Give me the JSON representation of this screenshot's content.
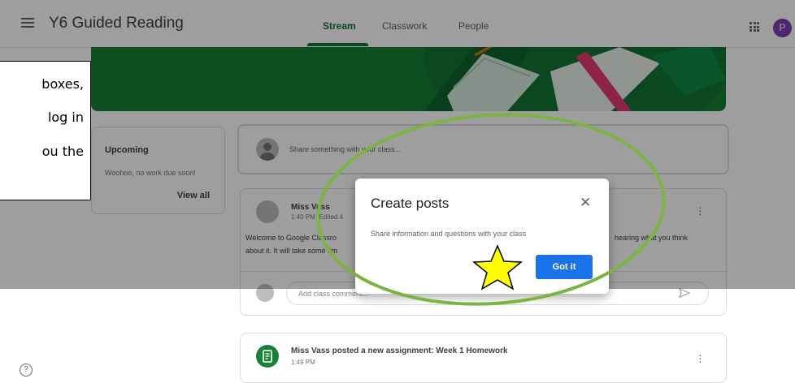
{
  "header": {
    "title": "Y6 Guided Reading",
    "tabs": [
      {
        "label": "Stream",
        "active": true
      },
      {
        "label": "Classwork",
        "active": false
      },
      {
        "label": "People",
        "active": false
      }
    ],
    "avatar_initial": "P"
  },
  "upcoming": {
    "title": "Upcoming",
    "subtitle": "Woohoo, no work due soon!",
    "view_all": "View all"
  },
  "share": {
    "placeholder": "Share something with your class..."
  },
  "post": {
    "author": "Miss Vass",
    "time": "1:40 PM (Edited 4",
    "body_left": "Welcome to Google Classro",
    "body_right": "hearing what you think",
    "body_line2": "about it. It will take some tim",
    "comment_placeholder": "Add class comment..."
  },
  "post2": {
    "title": "Miss Vass posted a new assignment: Week 1 Homework",
    "time": "1:49 PM"
  },
  "dialog": {
    "title": "Create posts",
    "text": "Share information and questions with your class",
    "button": "Got it"
  },
  "callout": {
    "lines": [
      "boxes,",
      "log in",
      "ou the"
    ]
  },
  "colors": {
    "accent": "#137333",
    "banner": "#188038",
    "primary_button": "#1a73e8",
    "annotation_ellipse": "#7cb342",
    "annotation_star": "#ffff00"
  }
}
